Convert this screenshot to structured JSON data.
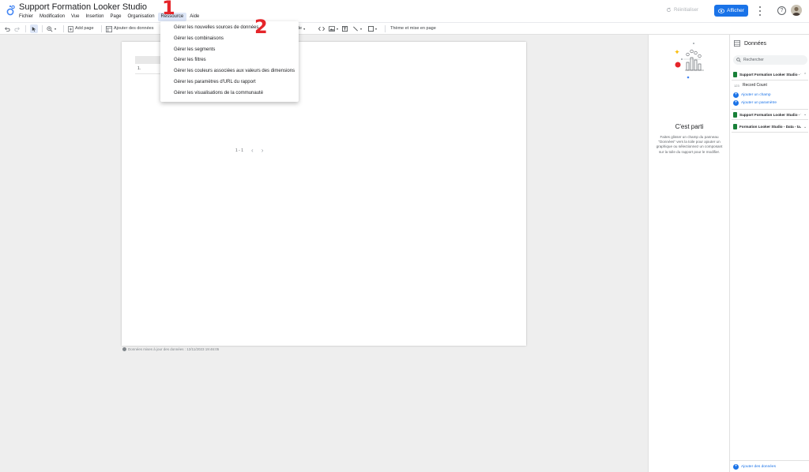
{
  "header": {
    "title": "Support Formation Looker Studio",
    "menu": [
      "Fichier",
      "Modification",
      "Vue",
      "Insertion",
      "Page",
      "Organisation",
      "Ressource",
      "Aide"
    ],
    "active_menu": "Ressource",
    "reinit_label": "Réinitialiser",
    "view_label": "Afficher"
  },
  "toolbar": {
    "add_page": "Add page",
    "add_data": "Ajouter des données",
    "partial_label": "de",
    "theme_label": "Thème et mise en page"
  },
  "dropdown": {
    "items": [
      "Gérer les nouvelles sources de données",
      "Gérer les combinaisons",
      "Gérer les segments",
      "Gérer les filtres",
      "Gérer les couleurs associées aux valeurs des dimensions",
      "Gérer les paramètres d'URL du rapport",
      "Gérer les visualisations de la communauté"
    ]
  },
  "annotations": {
    "step1": "1",
    "step2": "2"
  },
  "canvas": {
    "row_number": "1.",
    "pagination": "1 - 1",
    "last_refresh": "Données mises à jour des données : 12/11/2023 19:46:05"
  },
  "properties_panel": {
    "title": "C'est parti",
    "description": "Faites glisser un champ du panneau \"Données\" vers la toile pour ajouter un graphique ou sélectionnez un composant sur la toile du rapport pour le modifier."
  },
  "data_panel": {
    "title": "Données",
    "search_placeholder": "Rechercher",
    "sources": [
      "Support Formation Looker Studio - t...",
      "Support Formation Looker Studio - t...",
      "Formation Looker Studio - Data - ta..."
    ],
    "field_type": "123",
    "field_name": "Record Count",
    "add_field": "Ajouter un champ",
    "add_param": "Ajouter un paramètre",
    "add_data": "Ajouter des données"
  },
  "colors": {
    "accent": "#1a73e8",
    "annotation": "#e5252a",
    "sheet_green": "#188038"
  }
}
